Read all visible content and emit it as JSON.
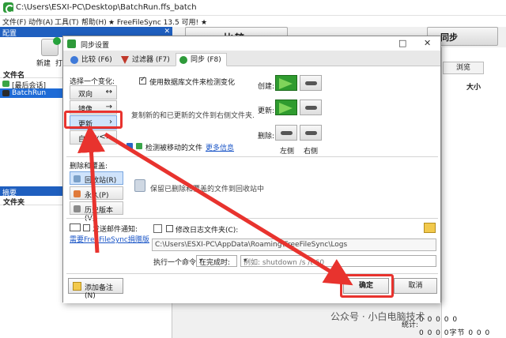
{
  "window": {
    "title": "C:\\Users\\ESXI-PC\\Desktop\\BatchRun.ffs_batch"
  },
  "menu": [
    "文件(F)",
    "动作(A)",
    "工具(T)",
    "帮助(H)",
    "★ FreeFileSync 13.5 可用! ★"
  ],
  "left_panel": {
    "config_header": "配置",
    "close_glyph": "✕",
    "new_label": "新建",
    "open_label": "打",
    "list_header": "文件名",
    "items": [
      "[最后会话]",
      "BatchRun"
    ],
    "summary_header": "摘要",
    "summary_close": "✕",
    "folder_header": "文件夹"
  },
  "toolbar": {
    "compare_label": "比较",
    "sync_label": "同步",
    "browse_label": "浏览",
    "size_column": "大小"
  },
  "status": {
    "stats_label": "统计:",
    "zeros_row1": "0  0  0  0  0",
    "zeros_row2": "0  0  0  0字节  0  0  0"
  },
  "watermark": "公众号 · 小白电脑技术",
  "dialog": {
    "title": "同步设置",
    "controls": [
      "□",
      "✕"
    ],
    "tabs": [
      {
        "label": "比较 (F6)"
      },
      {
        "label": "过滤器 (F7)"
      },
      {
        "label": "同步 (F8)"
      }
    ],
    "variant_header": "选择一个变化:",
    "variants": [
      {
        "label": "双向",
        "arrow": "↔"
      },
      {
        "label": "镜像",
        "arrow": "→"
      },
      {
        "label": "更新",
        "arrow": "›"
      },
      {
        "label": "自定义",
        "arrow": "<>"
      }
    ],
    "db_checkbox_label": "使用数据库文件来检测变化",
    "description": "复制新的和已更新的文件到右侧文件夹.",
    "detect_moved_label": "检测被移动的文件",
    "more_info_link": "更多信息",
    "action_labels": {
      "create": "创建:",
      "update": "更新:",
      "delete": "删除:"
    },
    "left_label": "左侧",
    "right_label": "右侧",
    "delete_section_header": "删除和覆盖:",
    "delete_options": [
      "回收站(R)",
      "永久(P)",
      "历史版本(V)"
    ],
    "delete_description": "保留已删除和覆盖的文件到回收站中",
    "email_checkbox_label": "发送邮件通知:",
    "donate_link": "需要FreeFileSync捐赠版",
    "log_checkbox_label": "修改日志文件夹(C):",
    "log_path": "C:\\Users\\ESXI-PC\\AppData\\Roaming\\FreeFileSync\\Logs",
    "command_label": "执行一个命令:",
    "command_when": "在完成时:",
    "command_placeholder": "例如: shutdown /s /t 60",
    "add_note_label": "添加备注(N)",
    "ok_label": "确定",
    "cancel_label": "取消"
  },
  "colors": {
    "highlight": "#e8332e",
    "selection": "#1e6bd6",
    "green_action": "#2f9b2f"
  }
}
